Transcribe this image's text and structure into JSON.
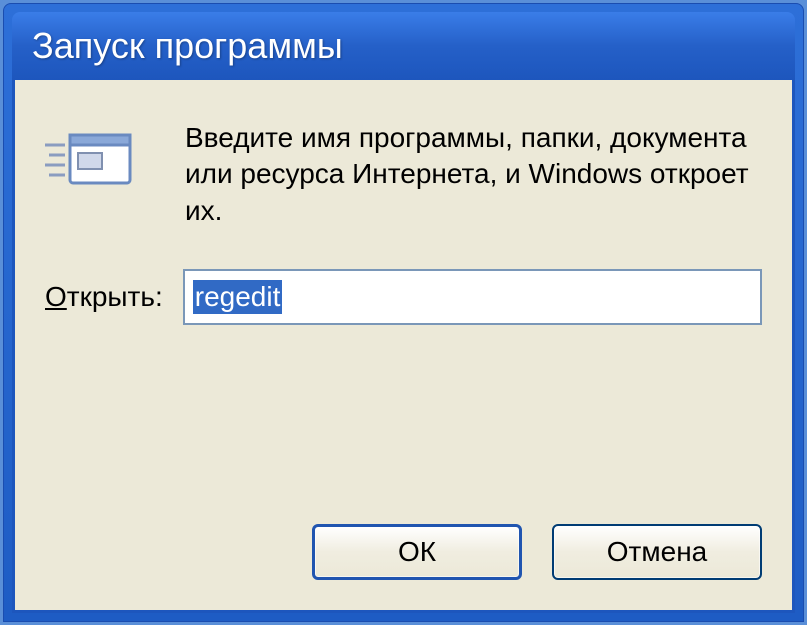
{
  "window": {
    "title": "Запуск программы"
  },
  "content": {
    "description": "Введите имя программы, папки, документа или ресурса Интернета, и Windows откроет их.",
    "open_label_underlined": "О",
    "open_label_rest": "ткрыть:"
  },
  "input": {
    "value": "regedit"
  },
  "buttons": {
    "ok": "ОК",
    "cancel": "Отмена"
  },
  "icon": {
    "name": "run-program-icon"
  }
}
